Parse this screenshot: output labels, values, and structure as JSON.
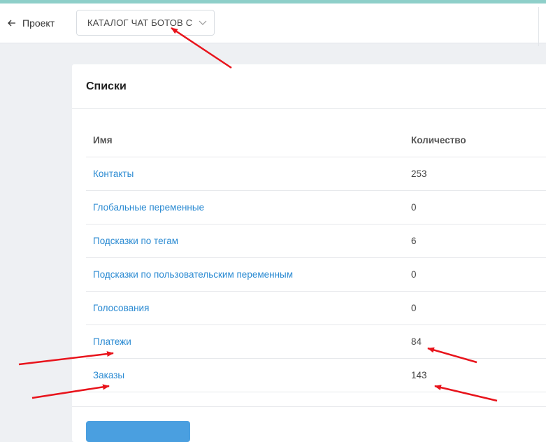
{
  "header": {
    "back_label": "Проект",
    "project_name": "КАТАЛОГ ЧАТ БОТОВ С"
  },
  "card": {
    "title": "Списки",
    "columns": {
      "name": "Имя",
      "count": "Количество"
    },
    "rows": [
      {
        "name": "Контакты",
        "count": "253"
      },
      {
        "name": "Глобальные переменные",
        "count": "0"
      },
      {
        "name": "Подсказки по тегам",
        "count": "6"
      },
      {
        "name": "Подсказки по пользовательским переменным",
        "count": "0"
      },
      {
        "name": "Голосования",
        "count": "0"
      },
      {
        "name": "Платежи",
        "count": "84"
      },
      {
        "name": "Заказы",
        "count": "143"
      }
    ]
  },
  "colors": {
    "accent": "#2a8ad2",
    "annotation_arrow": "#e8141c",
    "top_strip": "#8ecfc9"
  }
}
